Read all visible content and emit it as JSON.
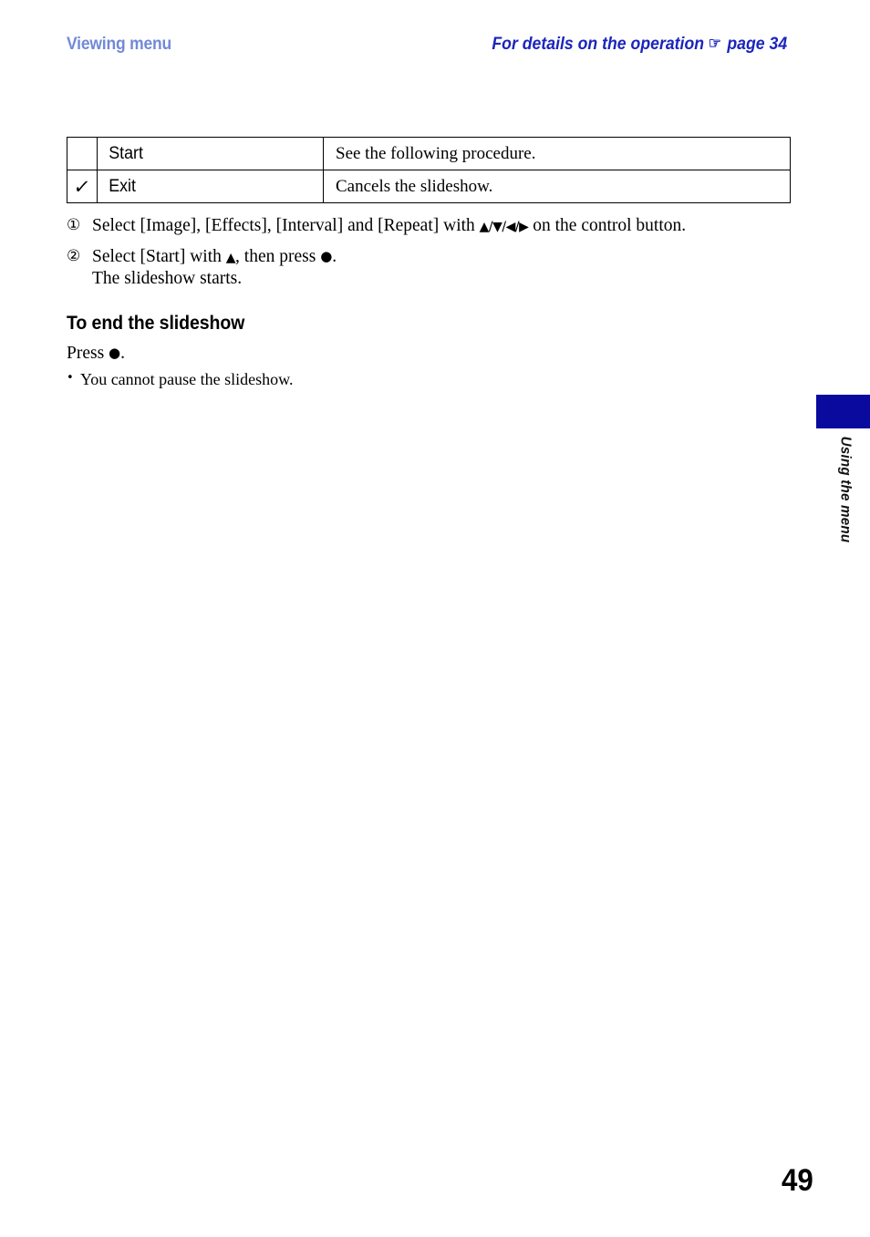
{
  "header": {
    "left_title": "Viewing menu",
    "right_title_before": "For details on the operation",
    "hand_icon": "☞",
    "right_title_after": "page 34"
  },
  "table": {
    "rows": [
      {
        "checked": false,
        "check_glyph": "",
        "label": "Start",
        "description": "See the following procedure."
      },
      {
        "checked": true,
        "check_glyph": "✓",
        "label": "Exit",
        "description": "Cancels the slideshow."
      }
    ]
  },
  "steps": [
    {
      "number": "①",
      "text_1": "Select [Image], [Effects], [Interval] and [Repeat] with ",
      "symbols": "▲/▼/◀/▶",
      "text_2": " on the control button.",
      "sub": ""
    },
    {
      "number": "②",
      "text_1": "Select [Start] with ",
      "symbols": "▲",
      "text_2": ", then press ",
      "button": "●",
      "text_3": ".",
      "sub": "The slideshow starts."
    }
  ],
  "section": {
    "heading": "To end the slideshow",
    "press_label": "Press ",
    "press_button": "●",
    "press_period": ".",
    "notes": [
      {
        "bullet": "•",
        "text": "You cannot pause the slideshow."
      }
    ]
  },
  "side_tab": {
    "label": "Using the menu",
    "color": "#0a0a9e"
  },
  "folio": {
    "page_number": "49"
  }
}
